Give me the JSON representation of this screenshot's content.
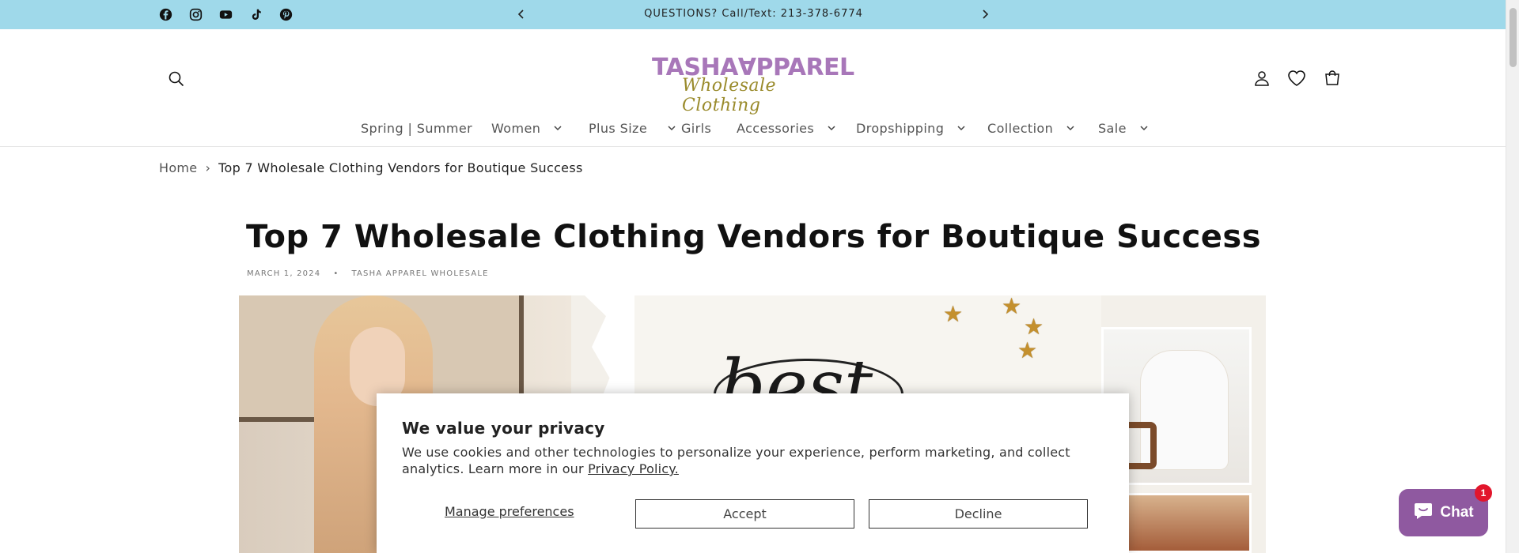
{
  "announcement": {
    "text": "QUESTIONS? Call/Text: 213-378-6774",
    "social_icons": [
      "facebook-icon",
      "instagram-icon",
      "youtube-icon",
      "tiktok-icon",
      "pinterest-icon"
    ]
  },
  "brand": {
    "logo_top": "TASHA∀PPAREL",
    "logo_bottom": "Wholesale Clothing",
    "accent": "#a877b9",
    "script_color": "#9a8b2c",
    "bar_color": "#9fd9ea"
  },
  "nav": {
    "items": [
      {
        "label": "Spring | Summer",
        "has_dropdown": false
      },
      {
        "label": "Women",
        "has_dropdown": true
      },
      {
        "label": "Plus Size",
        "has_dropdown": true
      },
      {
        "label": "Girls",
        "has_dropdown": false
      },
      {
        "label": "Accessories",
        "has_dropdown": true
      },
      {
        "label": "Dropshipping",
        "has_dropdown": true
      },
      {
        "label": "Collection",
        "has_dropdown": true
      },
      {
        "label": "Sale",
        "has_dropdown": true
      }
    ]
  },
  "breadcrumb": {
    "home": "Home",
    "separator": "›",
    "current": "Top 7 Wholesale Clothing Vendors for Boutique Success"
  },
  "article": {
    "title": "Top 7 Wholesale Clothing Vendors for Boutique Success",
    "date": "MARCH 1, 2024",
    "dot": "•",
    "author": "TASHA APPAREL WHOLESALE"
  },
  "privacy": {
    "title": "We value your privacy",
    "text": "We use cookies and other technologies to personalize your experience, perform marketing, and collect analytics. Learn more in our ",
    "link": "Privacy Policy.",
    "manage": "Manage preferences",
    "accept": "Accept",
    "decline": "Decline"
  },
  "chat": {
    "label": "Chat",
    "badge": "1",
    "color": "#8f59a0"
  }
}
